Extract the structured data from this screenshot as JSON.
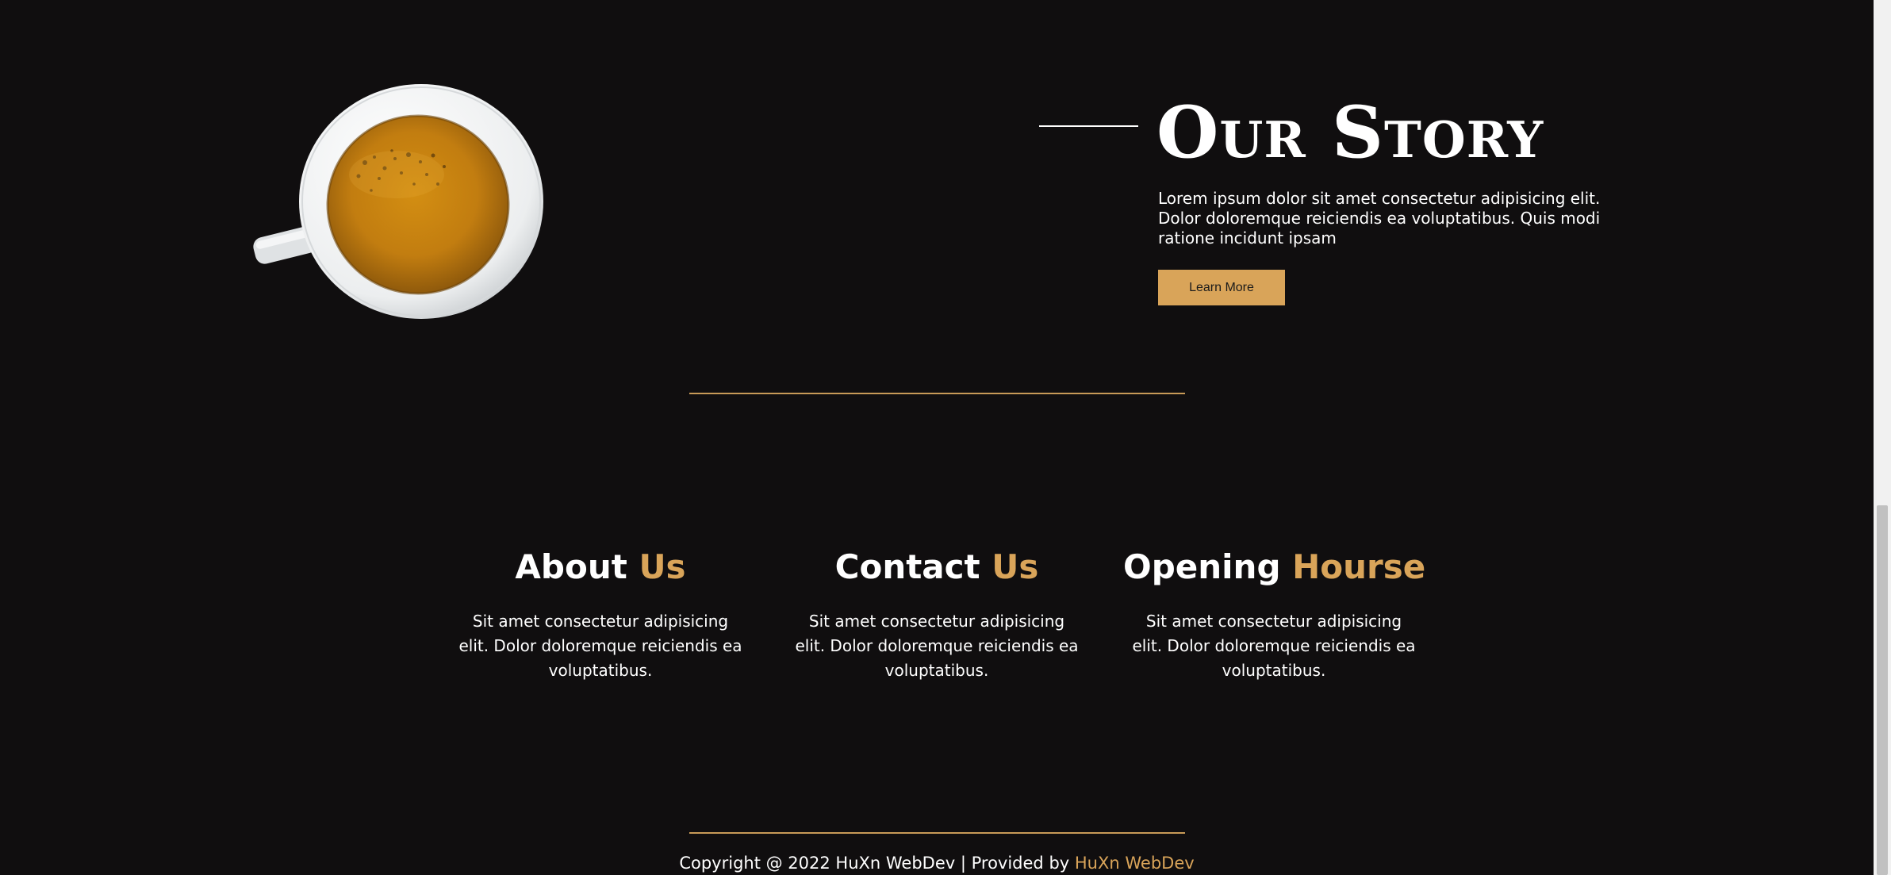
{
  "story": {
    "title": "Our Story",
    "text": "Lorem ipsum dolor sit amet consectetur adipisicing elit. Dolor doloremque reiciendis ea voluptatibus. Quis modi ratione incidunt ipsam",
    "button_label": "Learn More"
  },
  "columns": [
    {
      "title_main": "About",
      "title_accent": "Us",
      "text": "Sit amet consectetur adipisicing elit. Dolor doloremque reiciendis ea voluptatibus."
    },
    {
      "title_main": "Contact",
      "title_accent": "Us",
      "text": "Sit amet consectetur adipisicing elit. Dolor doloremque reiciendis ea voluptatibus."
    },
    {
      "title_main": "Opening",
      "title_accent": "Hourse",
      "text": "Sit amet consectetur adipisicing elit. Dolor doloremque reiciendis ea voluptatibus."
    }
  ],
  "footer": {
    "text": "Copyright @ 2022 HuXn WebDev | Provided by",
    "brand": "HuXn WebDev"
  },
  "colors": {
    "background": "#100e0f",
    "accent": "#d9a459",
    "text": "#ffffff"
  },
  "icons": {
    "cup": "coffee-cup-image"
  }
}
